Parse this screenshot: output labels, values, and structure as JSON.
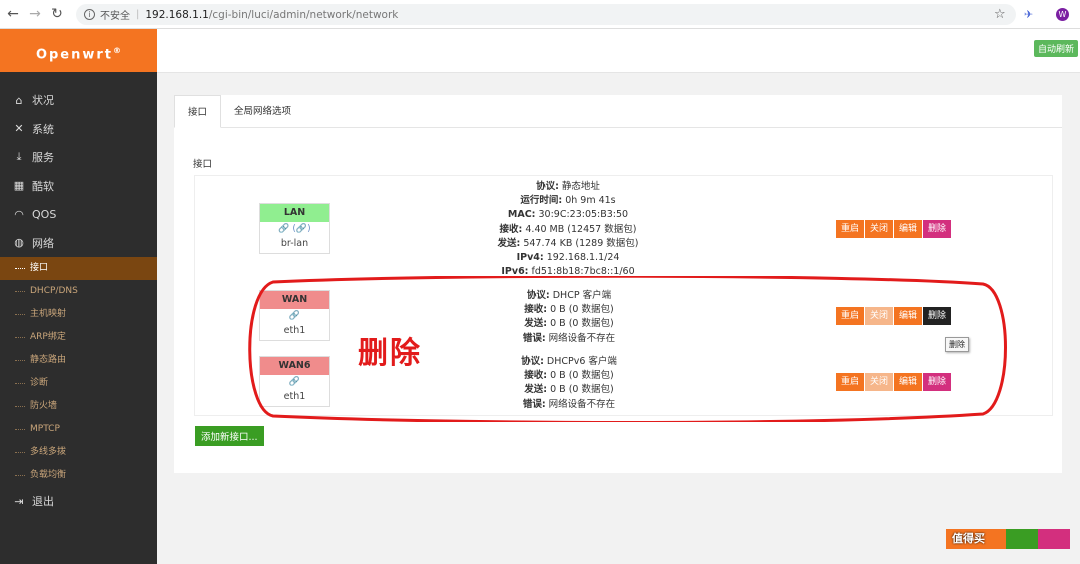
{
  "browser": {
    "insecure_label": "不安全",
    "url_host": "192.168.1.1",
    "url_path": "/cgi-bin/luci/admin/network/network",
    "ext_w": "W"
  },
  "brand": {
    "name": "Openwrt",
    "mark": "®"
  },
  "sidebar": {
    "top": [
      {
        "label": "状况",
        "icon": "home-icon"
      },
      {
        "label": "系统",
        "icon": "wrench-icon"
      },
      {
        "label": "服务",
        "icon": "download-icon"
      },
      {
        "label": "酷软",
        "icon": "calendar-icon"
      },
      {
        "label": "QOS",
        "icon": "gauge-icon"
      },
      {
        "label": "网络",
        "icon": "globe-icon"
      }
    ],
    "network_sub": [
      "接口",
      "DHCP/DNS",
      "主机映射",
      "ARP绑定",
      "静态路由",
      "诊断",
      "防火墙",
      "MPTCP",
      "多线多拨",
      "负载均衡"
    ],
    "logout": "退出"
  },
  "topbar": {
    "auto_refresh": "自动刷新"
  },
  "tabs": [
    "接口",
    "全局网络选项"
  ],
  "section_label": "接口",
  "interfaces": [
    {
      "name": "LAN",
      "icons": "🔗 (🔗)",
      "device": "br-lan",
      "info": [
        {
          "k": "协议:",
          "v": " 静态地址"
        },
        {
          "k": "运行时间:",
          "v": " 0h 9m 41s"
        },
        {
          "k": "MAC:",
          "v": " 30:9C:23:05:B3:50"
        },
        {
          "k": "接收:",
          "v": " 4.40 MB (12457 数据包)"
        },
        {
          "k": "发送:",
          "v": " 547.74 KB (1289 数据包)"
        },
        {
          "k": "IPv4:",
          "v": " 192.168.1.1/24"
        },
        {
          "k": "IPv6:",
          "v": " fd51:8b18:7bc8::1/60"
        }
      ]
    },
    {
      "name": "WAN",
      "icons": "🔗",
      "device": "eth1",
      "info": [
        {
          "k": "协议:",
          "v": " DHCP 客户端"
        },
        {
          "k": "接收:",
          "v": " 0 B (0 数据包)"
        },
        {
          "k": "发送:",
          "v": " 0 B (0 数据包)"
        },
        {
          "k": "错误:",
          "v": " 网络设备不存在"
        }
      ]
    },
    {
      "name": "WAN6",
      "icons": "🔗",
      "device": "eth1",
      "info": [
        {
          "k": "协议:",
          "v": " DHCPv6 客户端"
        },
        {
          "k": "接收:",
          "v": " 0 B (0 数据包)"
        },
        {
          "k": "发送:",
          "v": " 0 B (0 数据包)"
        },
        {
          "k": "错误:",
          "v": " 网络设备不存在"
        }
      ]
    }
  ],
  "buttons": {
    "restart": "重启",
    "stop": "关闭",
    "edit": "编辑",
    "delete": "删除"
  },
  "tooltip": "删除",
  "add_button": "添加新接口...",
  "annotation": "删除",
  "watermark": "值得买",
  "colors": {
    "brand": "#f47421",
    "sidebar": "#2d2d2d",
    "active_sub": "#7a4611",
    "lan": "#90ee90",
    "wan": "#f08c8c",
    "annotation": "#e21b1b"
  }
}
